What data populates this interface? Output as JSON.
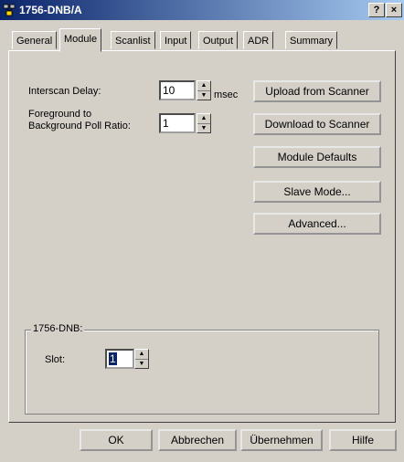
{
  "window": {
    "title": "1756-DNB/A",
    "help_button": "?",
    "close_button": "×"
  },
  "tabs": [
    {
      "label": "General",
      "active": false
    },
    {
      "label": "Module",
      "active": true
    },
    {
      "label": "Scanlist",
      "active": false
    },
    {
      "label": "Input",
      "active": false
    },
    {
      "label": "Output",
      "active": false
    },
    {
      "label": "ADR",
      "active": false
    },
    {
      "label": "Summary",
      "active": false
    }
  ],
  "module": {
    "interscan_delay": {
      "label": "Interscan Delay:",
      "value": "10",
      "unit": "msec"
    },
    "poll_ratio": {
      "label_line1": "Foreground to",
      "label_line2": "Background Poll Ratio:",
      "value": "1"
    },
    "buttons": {
      "upload": "Upload from Scanner",
      "download": "Download to Scanner",
      "defaults": "Module Defaults",
      "slave_mode": "Slave Mode...",
      "advanced": "Advanced..."
    },
    "group": {
      "title": "1756-DNB:",
      "slot_label": "Slot:",
      "slot_value": "1"
    }
  },
  "footer": {
    "ok": "OK",
    "cancel": "Abbrechen",
    "apply": "Übernehmen",
    "help": "Hilfe"
  }
}
